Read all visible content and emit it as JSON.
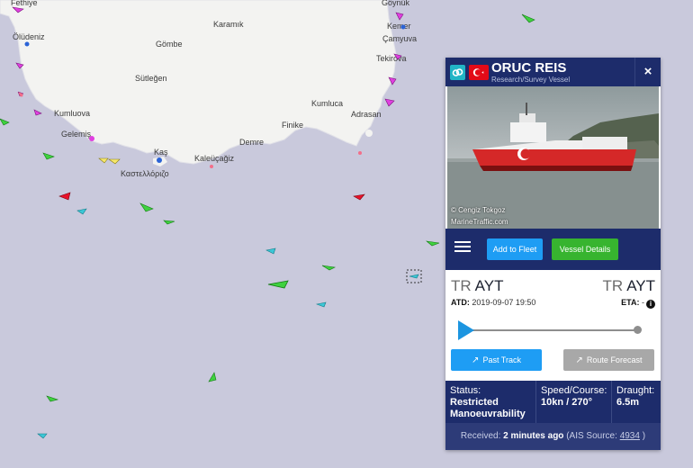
{
  "map": {
    "places": {
      "fethiye": "Fethiye",
      "oludeniz": "Ölüdeniz",
      "gombe": "Gömbe",
      "karamik": "Karamık",
      "suleygen": "Sütleğen",
      "kumluova": "Kumluova",
      "gelemis": "Gelemiş",
      "kas": "Kaş",
      "kastellorizo": "Καστελλόριζο",
      "kaleucagiz": "Kaleüçağiz",
      "demre": "Demre",
      "finike": "Finike",
      "kumluca": "Kumluca",
      "adrasan": "Adrasan",
      "goynuk": "Göynük",
      "kemer": "Kemer",
      "camyuva": "Çamyuva",
      "tekirova": "Tekirova"
    },
    "colors": {
      "sea": "#c9c9dc",
      "land": "#f3f3f1",
      "cargo": "#3fd13f",
      "tanker": "#e8122a",
      "passenger": "#3cc7d6",
      "pleasure": "#e040e0",
      "fishing": "#f7e86b"
    }
  },
  "popup": {
    "vessel_name": "ORUC REIS",
    "vessel_type": "Research/Survey Vessel",
    "link_icon": "link-icon",
    "flag_icon": "turkey-flag-icon",
    "close_label": "×",
    "photo_credit": "© Cengiz Tokgoz",
    "photo_site": "MarineTraffic.com",
    "add_to_fleet_label": "Add to Fleet",
    "vessel_details_label": "Vessel Details",
    "departure": {
      "country": "TR",
      "port": "AYT"
    },
    "arrival": {
      "country": "TR",
      "port": "AYT"
    },
    "atd_label": "ATD:",
    "atd_value": "2019-09-07 19:50",
    "eta_label": "ETA:",
    "eta_value": "-",
    "past_track_label": "Past Track",
    "route_forecast_label": "Route Forecast",
    "status_label": "Status:",
    "status_value": "Restricted Manoeuvrability",
    "speed_label": "Speed/Course:",
    "speed_value": "10kn / 270°",
    "draught_label": "Draught:",
    "draught_value": "6.5m",
    "received_label": "Received:",
    "received_value": "2 minutes ago",
    "ais_source_label": "(AIS Source:",
    "ais_source_value": "4934",
    "ais_source_close": ")"
  }
}
